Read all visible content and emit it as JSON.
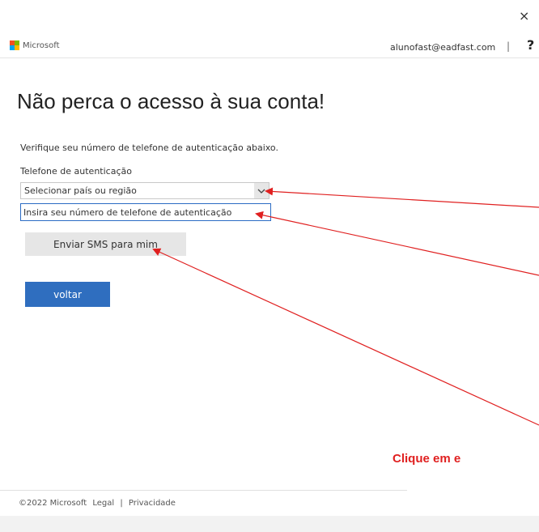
{
  "window": {
    "close_glyph": "×"
  },
  "header": {
    "logo_text": "Microsoft",
    "account": "alunofast@eadfast.com",
    "separator": "|",
    "help": "?"
  },
  "main": {
    "title": "Não perca o acesso à sua conta!",
    "description": "Verifique seu número de telefone de autenticação abaixo.",
    "phone_label": "Telefone de autenticação",
    "country_select": "Selecionar país ou região",
    "phone_placeholder": "Insira seu número de telefone de autenticação",
    "sms_button": "Enviar SMS para mim",
    "back_button": "voltar"
  },
  "annotation": {
    "text": "Clique em e"
  },
  "footer": {
    "copyright": "©2022 Microsoft",
    "legal": "Legal",
    "divider": "|",
    "privacy": "Privacidade"
  },
  "colors": {
    "accent": "#2f6ebf",
    "annotation": "#e02020",
    "ms_red": "#f25022",
    "ms_green": "#7fba00",
    "ms_blue": "#00a4ef",
    "ms_yellow": "#ffb900"
  },
  "icons": {
    "close": "close-icon",
    "help": "help-icon",
    "chevron": "chevron-down-icon"
  }
}
